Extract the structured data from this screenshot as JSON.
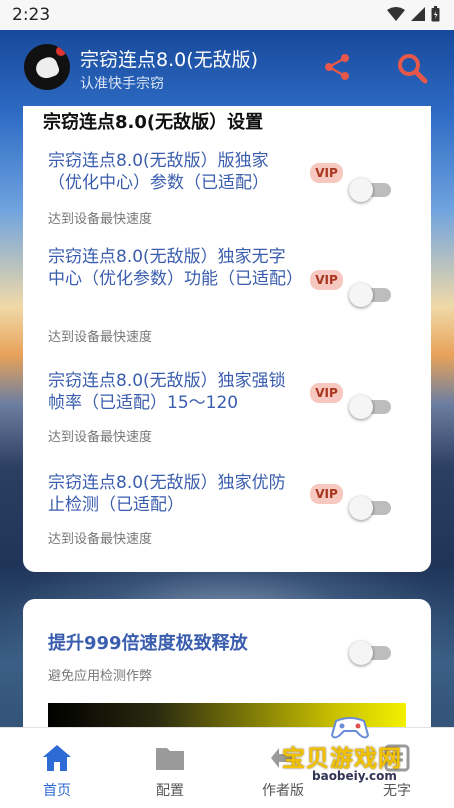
{
  "status_bar": {
    "time": "2:23"
  },
  "app_bar": {
    "title": "宗窃连点8.0(无敌版)",
    "subtitle": "认准快手宗窃"
  },
  "settings_card": {
    "title": "宗窃连点8.0(无敌版）设置",
    "items": [
      {
        "title": "宗窃连点8.0(无敌版）版独家（优化中心）参数（已适配）",
        "badge": "VIP",
        "desc": "达到设备最快速度",
        "enabled": false
      },
      {
        "title": "宗窃连点8.0(无敌版）独家无字中心（优化参数）功能（已适配）",
        "badge": "VIP",
        "desc": "达到设备最快速度",
        "enabled": false
      },
      {
        "title": "宗窃连点8.0(无敌版）独家强锁帧率（已适配）15～120",
        "badge": "VIP",
        "desc": "达到设备最快速度",
        "enabled": false
      },
      {
        "title": "宗窃连点8.0(无敌版）独家优防止检测（已适配）",
        "badge": "VIP",
        "desc": "达到设备最快速度",
        "enabled": false
      }
    ]
  },
  "boost_card": {
    "title": "提升999倍速度极致释放",
    "desc": "避免应用检测作弊",
    "enabled": false
  },
  "bottom_nav": {
    "items": [
      {
        "label": "首页",
        "icon": "home-icon",
        "active": true
      },
      {
        "label": "配置",
        "icon": "folder-icon",
        "active": false
      },
      {
        "label": "作者版",
        "icon": "author-icon",
        "active": false
      },
      {
        "label": "无字",
        "icon": "noword-icon",
        "active": false
      }
    ]
  },
  "watermark": {
    "text": "宝贝游戏网",
    "url": "baobeiy.com"
  },
  "colors": {
    "accent": "#2f6bd6",
    "title_blue": "#3a5dae",
    "vip_bg": "#f6c8bf",
    "vip_fg": "#a8351f"
  }
}
